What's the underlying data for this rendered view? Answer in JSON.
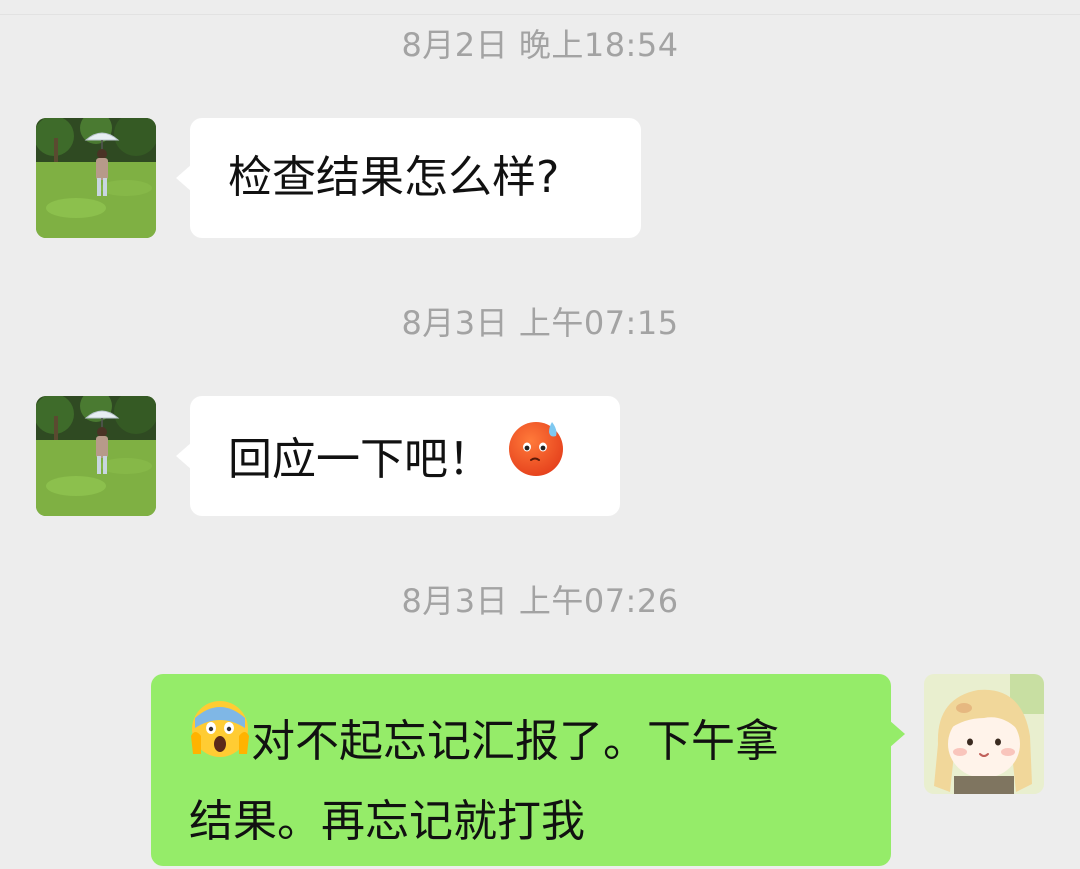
{
  "messages": [
    {
      "timestamp": "8月2日 晚上18:54",
      "direction": "incoming",
      "text": "检查结果怎么样?"
    },
    {
      "timestamp": "8月3日 上午07:15",
      "direction": "incoming",
      "text": "回应一下吧！",
      "trailing_emoji": "sweating-angry-face-emoji"
    },
    {
      "timestamp": "8月3日 上午07:26",
      "direction": "outgoing",
      "leading_emoji": "screaming-face-emoji",
      "line1": "对不起忘记汇报了。下午拿",
      "line2": "结果。再忘记就打我"
    }
  ],
  "colors": {
    "background": "#ededed",
    "incoming_bubble": "#ffffff",
    "outgoing_bubble": "#95ec69",
    "timestamp_text": "#a3a3a3"
  },
  "icons": {
    "contact_avatar": "photo-person-with-umbrella-on-grass",
    "self_avatar": "cartoon-girl-avatar"
  }
}
